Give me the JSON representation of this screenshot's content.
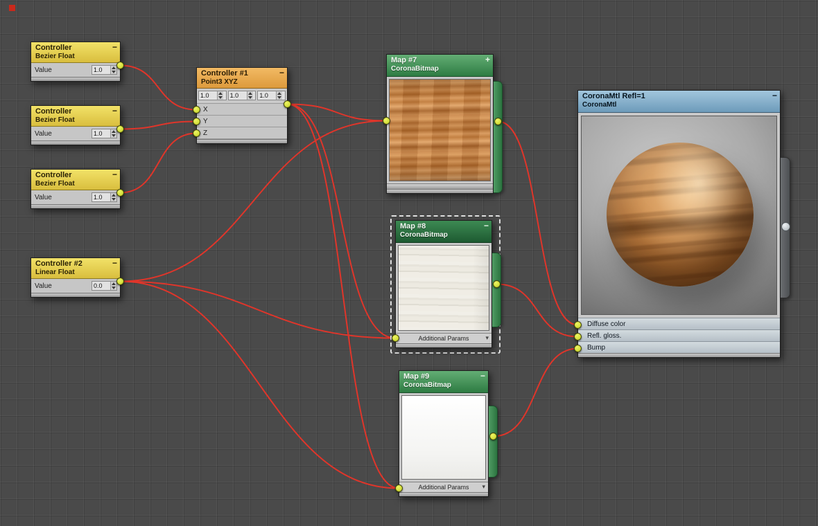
{
  "icons": {
    "rollout_arrow": "▾"
  },
  "colors": {
    "wire": "#e0352a",
    "socket": "#dfe94f"
  },
  "nodes": {
    "bezier1": {
      "title": "Controller",
      "subtitle": "Bezier Float",
      "collapse": "−",
      "value_label": "Value",
      "value": "1.0"
    },
    "bezier2": {
      "title": "Controller",
      "subtitle": "Bezier Float",
      "collapse": "−",
      "value_label": "Value",
      "value": "1.0"
    },
    "bezier3": {
      "title": "Controller",
      "subtitle": "Bezier Float",
      "collapse": "−",
      "value_label": "Value",
      "value": "1.0"
    },
    "linear": {
      "title": "Controller #2",
      "subtitle": "Linear Float",
      "collapse": "−",
      "value_label": "Value",
      "value": "0.0"
    },
    "point3": {
      "title": "Controller #1",
      "subtitle": "Point3 XYZ",
      "collapse": "−",
      "spinners": [
        "1.0",
        "1.0",
        "1.0"
      ],
      "rows": [
        "X",
        "Y",
        "Z"
      ]
    },
    "map7": {
      "title": "Map #7",
      "subtitle": "CoronaBitmap",
      "icon": "+"
    },
    "map8": {
      "title": "Map #8",
      "subtitle": "CoronaBitmap",
      "icon": "−",
      "footer": "Additional Params"
    },
    "map9": {
      "title": "Map #9",
      "subtitle": "CoronaBitmap",
      "icon": "−",
      "footer": "Additional Params"
    },
    "material": {
      "title": "CoronaMtl Refl=1",
      "subtitle": "CoronaMtl",
      "icon": "−",
      "slots": [
        "Diffuse color",
        "Refl. gloss.",
        "Bump"
      ]
    }
  },
  "edges": [
    {
      "from": "bezier1.out",
      "to": "point3.x"
    },
    {
      "from": "bezier2.out",
      "to": "point3.y"
    },
    {
      "from": "bezier3.out",
      "to": "point3.z"
    },
    {
      "from": "point3.out",
      "to": "map7.in"
    },
    {
      "from": "point3.out",
      "to": "map8.params"
    },
    {
      "from": "point3.out",
      "to": "map9.params"
    },
    {
      "from": "linear.out",
      "to": "map7.in"
    },
    {
      "from": "linear.out",
      "to": "map8.params"
    },
    {
      "from": "linear.out",
      "to": "map9.params"
    },
    {
      "from": "map7.out",
      "to": "material.diffuse"
    },
    {
      "from": "map8.out",
      "to": "material.gloss"
    },
    {
      "from": "map9.out",
      "to": "material.bump"
    }
  ]
}
